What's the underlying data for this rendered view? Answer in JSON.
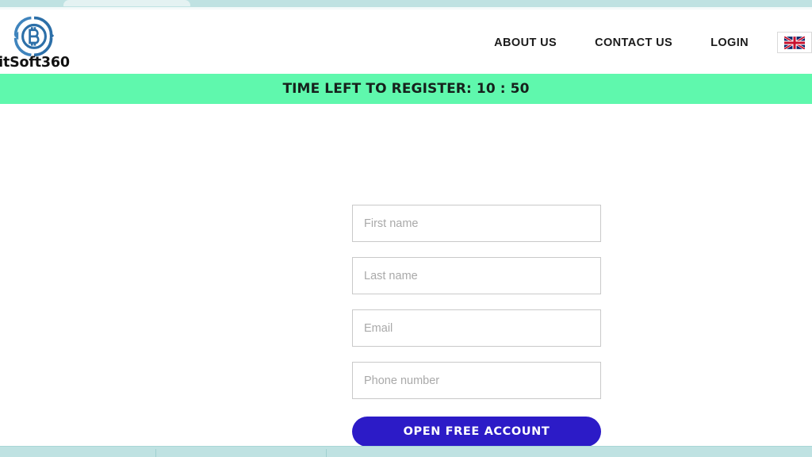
{
  "browser": {
    "tab_label": ""
  },
  "header": {
    "brand": {
      "name": "itSoft360",
      "logo_icon": "bitcoin-target-logo-icon"
    },
    "nav": [
      {
        "label": "ABOUT US",
        "name": "nav-link-about-us"
      },
      {
        "label": "CONTACT US",
        "name": "nav-link-contact-us"
      },
      {
        "label": "LOGIN",
        "name": "nav-link-login"
      }
    ],
    "language": {
      "icon": "uk-flag-icon",
      "selected": "EN"
    }
  },
  "banner": {
    "countdown_text": "TIME LEFT TO REGISTER: 10 : 50",
    "background_color": "#5FF8AD",
    "text_color": "#16211C"
  },
  "signup_form": {
    "fields": [
      {
        "name": "first-name-input",
        "placeholder": "First name",
        "value": ""
      },
      {
        "name": "last-name-input",
        "placeholder": "Last name",
        "value": ""
      },
      {
        "name": "email-input",
        "placeholder": "Email",
        "value": ""
      },
      {
        "name": "phone-input",
        "placeholder": "Phone number",
        "value": ""
      }
    ],
    "submit_label": "OPEN FREE ACCOUNT",
    "submit_color": "#2C1BC7"
  },
  "footer_strip": {
    "background_color": "#BFE2E2"
  }
}
